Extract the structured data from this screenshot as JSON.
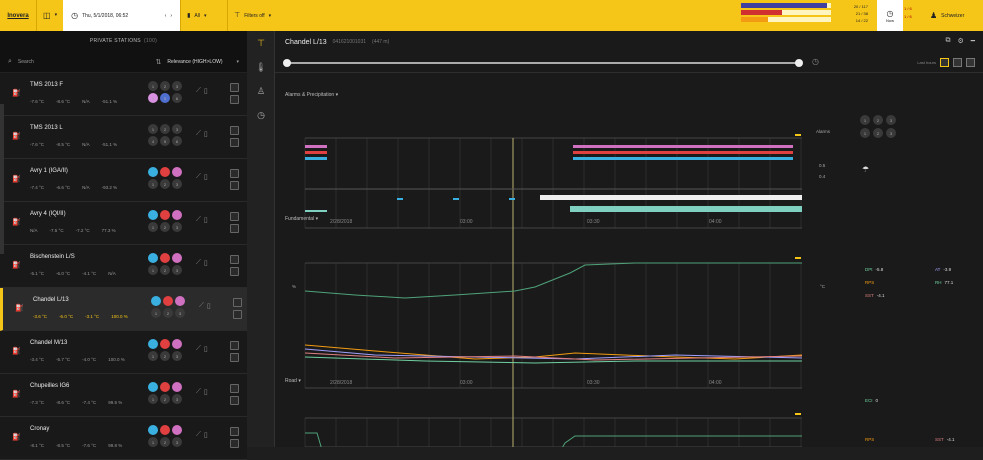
{
  "topbar": {
    "logo": "Inovera",
    "date": "Thu, 5/1/2018, 06:52",
    "date_prev": "‹",
    "date_next": "›",
    "all_label": "All",
    "filters_label": "Filters off",
    "status_bars": [
      {
        "fill": 0.95,
        "color": "#3f3f9f",
        "value": "20 / 117"
      },
      {
        "fill": 0.45,
        "color": "#d03030",
        "value": "21 / 38"
      },
      {
        "fill": 0.3,
        "color": "#f39c12",
        "value": "14 / 22"
      }
    ],
    "now_label": "Now",
    "now_values": [
      "1 / 6",
      "1 / 6"
    ],
    "user_label": "Schweizer"
  },
  "left_panel": {
    "title": "PRIVATE STATIONS",
    "count": "(100)",
    "search_placeholder": "Search",
    "sort_label": "Relevance (HIGH>LOW)",
    "stations": [
      {
        "name": "TMS 2013 F",
        "vals": [
          "-7.6 °C",
          "-8.6 °C",
          "N/A",
          "-51.1 %"
        ],
        "dots": [
          "1",
          "2",
          "3",
          "4",
          "5",
          "6"
        ],
        "dotcolors": [
          "#3a3a3a",
          "#3a3a3a",
          "#3a3a3a",
          "#d890e0",
          "#4f6fd0",
          "#3a3a3a"
        ],
        "selected": false
      },
      {
        "name": "TMS 2013 L",
        "vals": [
          "-7.6 °C",
          "-8.5 °C",
          "N/A",
          "-51.1 %"
        ],
        "dots": [
          "1",
          "2",
          "3",
          "4",
          "5",
          "6"
        ],
        "dotcolors": [
          "#3a3a3a",
          "#3a3a3a",
          "#3a3a3a",
          "#3a3a3a",
          "#3a3a3a",
          "#3a3a3a"
        ],
        "selected": false
      },
      {
        "name": "Avry 1 (IGA/II)",
        "vals": [
          "-7.4 °C",
          "-6.6 °C",
          "N/A",
          "-93.2 %"
        ],
        "dots": [
          "",
          "",
          "",
          "1",
          "2",
          "3"
        ],
        "dotcolors": [
          "#3ab0e0",
          "#e04040",
          "#d070c0",
          "#3a3a3a",
          "#3a3a3a",
          "#3a3a3a"
        ],
        "selected": false
      },
      {
        "name": "Avry 4 (IQI/II)",
        "vals": [
          "N/A",
          "-7.5 °C",
          "-7.2 °C",
          "77.3 %"
        ],
        "dots": [
          "",
          "",
          "",
          "1",
          "2",
          "3"
        ],
        "dotcolors": [
          "#3ab0e0",
          "#e04040",
          "#d070c0",
          "#3a3a3a",
          "#3a3a3a",
          "#3a3a3a"
        ],
        "selected": false
      },
      {
        "name": "Bischenstein L/S",
        "vals": [
          "-5.1 °C",
          "-6.0 °C",
          "-4.1 °C",
          "N/A"
        ],
        "dots": [
          "",
          "",
          "",
          "1",
          "2",
          "3"
        ],
        "dotcolors": [
          "#3ab0e0",
          "#e04040",
          "#d070c0",
          "#3a3a3a",
          "#3a3a3a",
          "#3a3a3a"
        ],
        "selected": false
      },
      {
        "name": "Chandel L/13",
        "vals": [
          "-3.6 °C",
          "-6.0 °C",
          "-3.1 °C",
          "100.0 %"
        ],
        "dots": [
          "",
          "",
          "",
          "1",
          "2",
          "3"
        ],
        "dotcolors": [
          "#3ab0e0",
          "#e04040",
          "#d070c0",
          "#3a3a3a",
          "#3a3a3a",
          "#3a3a3a"
        ],
        "selected": true
      },
      {
        "name": "Chandel M/13",
        "vals": [
          "-3.4 °C",
          "-5.7 °C",
          "-4.0 °C",
          "100.0 %"
        ],
        "dots": [
          "",
          "",
          "",
          "1",
          "2",
          "3"
        ],
        "dotcolors": [
          "#3ab0e0",
          "#e04040",
          "#d070c0",
          "#3a3a3a",
          "#3a3a3a",
          "#3a3a3a"
        ],
        "selected": false
      },
      {
        "name": "Chupeilles IG6",
        "vals": [
          "-7.3 °C",
          "-8.6 °C",
          "-7.4 °C",
          "99.5 %"
        ],
        "dots": [
          "",
          "",
          "",
          "1",
          "2",
          "3"
        ],
        "dotcolors": [
          "#3ab0e0",
          "#e04040",
          "#d070c0",
          "#3a3a3a",
          "#3a3a3a",
          "#3a3a3a"
        ],
        "selected": false
      },
      {
        "name": "Cronay",
        "vals": [
          "-8.1 °C",
          "-8.5 °C",
          "-7.6 °C",
          "99.8 %"
        ],
        "dots": [
          "",
          "",
          "",
          "1",
          "2",
          "3"
        ],
        "dotcolors": [
          "#3ab0e0",
          "#e04040",
          "#d070c0",
          "#3a3a3a",
          "#3a3a3a",
          "#3a3a3a"
        ],
        "selected": false
      }
    ]
  },
  "main": {
    "title": "Chandel L/13",
    "subtitle": "041621001031",
    "subtitle2": "(447 m)",
    "time_label": "Last hours",
    "alarms_panel": {
      "label": "Alarms & Precipitation",
      "side_label": "Alarms",
      "r1": "0.5",
      "r2": "0.4"
    },
    "fundamental_panel": {
      "label": "Fundamental",
      "unit_left": "%",
      "unit_right": "°C",
      "legend": [
        {
          "k": "DPt",
          "v": "-5.8",
          "color": "#6fd0a0"
        },
        {
          "k": "RPS",
          "v": "",
          "color": "#f39c12"
        },
        {
          "k": "SST",
          "v": "-4.1",
          "color": "#e08080"
        },
        {
          "k": "AT",
          "v": "-3.9",
          "color": "#a0a0ff"
        },
        {
          "k": "RH",
          "v": "77.1",
          "color": "#6fd0a0"
        }
      ]
    },
    "road_panel": {
      "label": "Road",
      "legend": [
        {
          "k": "ECI",
          "v": "0",
          "color": "#6fd0a0"
        }
      ],
      "bottom": [
        {
          "k": "RPS",
          "v": ""
        },
        {
          "k": "SST",
          "v": "-4.1"
        }
      ]
    },
    "x_ticks": [
      "2/28/2018",
      "03:00",
      "03:30",
      "04:00"
    ]
  }
}
